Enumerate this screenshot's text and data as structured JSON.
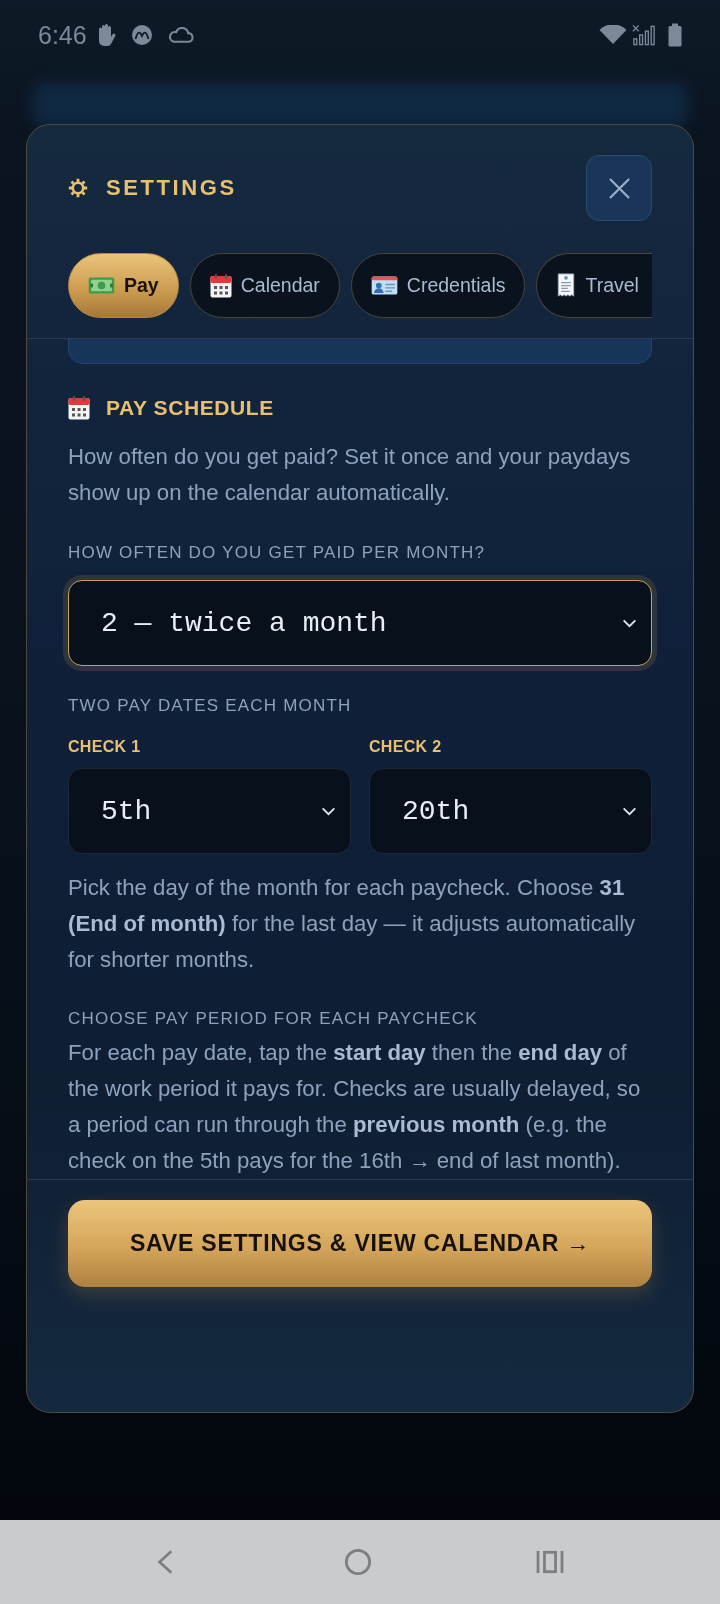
{
  "status_bar": {
    "time": "6:46"
  },
  "dialog": {
    "title": "SETTINGS",
    "tabs": [
      {
        "label": "Pay",
        "selected": true
      },
      {
        "label": "Calendar",
        "selected": false
      },
      {
        "label": "Credentials",
        "selected": false
      },
      {
        "label": "Travel",
        "selected": false
      }
    ],
    "section": {
      "title": "PAY SCHEDULE",
      "intro": "How often do you get paid? Set it once and your paydays show up on the calendar automatically.",
      "frequency": {
        "label": "HOW OFTEN DO YOU GET PAID PER MONTH?",
        "value": "2 — twice a month",
        "focused": true
      },
      "pay_dates": {
        "label": "TWO PAY DATES EACH MONTH",
        "checks": [
          {
            "label": "CHECK 1",
            "value": "5th",
            "focused": false
          },
          {
            "label": "CHECK 2",
            "value": "20th",
            "focused": false
          }
        ],
        "help": "Pick the day of the month for each paycheck. Choose **31 (End of month)** for the last day — it adjusts automatically for shorter months."
      },
      "pay_period": {
        "label": "CHOOSE PAY PERIOD FOR EACH PAYCHECK",
        "help": "For each pay date, tap the **start day** then the **end day** of the work period it pays for. Checks are usually delayed, so a period can run through the **previous month** (e.g. the check on the 5th pays for the 16th → end of last month)."
      }
    },
    "save_button": "SAVE SETTINGS & VIEW CALENDAR →"
  }
}
